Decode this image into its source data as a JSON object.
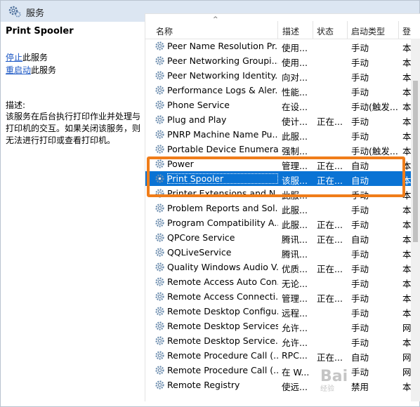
{
  "window": {
    "title": "服务",
    "icon": "gear-icon"
  },
  "left_pane": {
    "service_title": "Print Spooler",
    "actions": [
      {
        "link": "停止",
        "suffix": "此服务"
      },
      {
        "link": "重启动",
        "suffix": "此服务"
      }
    ],
    "description_label": "描述:",
    "description_text": "该服务在后台执行打印作业并处理与打印机的交互。如果关闭该服务，则无法进行打印或查看打印机。"
  },
  "table": {
    "columns": [
      "名称",
      "描述",
      "状态",
      "启动类型",
      "登"
    ],
    "sorted_column": "名称",
    "rows": [
      {
        "name": "Peer Name Resolution Pr...",
        "desc": "使用...",
        "status": "",
        "startup": "手动",
        "more": "本"
      },
      {
        "name": "Peer Networking Groupi...",
        "desc": "使用...",
        "status": "",
        "startup": "手动",
        "more": "本"
      },
      {
        "name": "Peer Networking Identity...",
        "desc": "向对...",
        "status": "",
        "startup": "手动",
        "more": "本"
      },
      {
        "name": "Performance Logs & Aler...",
        "desc": "性能...",
        "status": "",
        "startup": "手动",
        "more": "本"
      },
      {
        "name": "Phone Service",
        "desc": "在设...",
        "status": "",
        "startup": "手动(触发...",
        "more": "本"
      },
      {
        "name": "Plug and Play",
        "desc": "使计...",
        "status": "正在...",
        "startup": "手动",
        "more": "本"
      },
      {
        "name": "PNRP Machine Name Pu...",
        "desc": "此服...",
        "status": "",
        "startup": "手动",
        "more": "本"
      },
      {
        "name": "Portable Device Enumera...",
        "desc": "强制...",
        "status": "",
        "startup": "手动(触发...",
        "more": "本"
      },
      {
        "name": "Power",
        "desc": "管理...",
        "status": "正在...",
        "startup": "自动",
        "more": "本"
      },
      {
        "name": "Print Spooler",
        "desc": "该服...",
        "status": "正在...",
        "startup": "自动",
        "more": "本",
        "selected": true
      },
      {
        "name": "Printer Extensions and N...",
        "desc": "此服...",
        "status": "",
        "startup": "手动",
        "more": "本"
      },
      {
        "name": "Problem Reports and Sol...",
        "desc": "此服...",
        "status": "",
        "startup": "手动",
        "more": "本"
      },
      {
        "name": "Program Compatibility A...",
        "desc": "此服...",
        "status": "正在...",
        "startup": "手动",
        "more": "本"
      },
      {
        "name": "QPCore Service",
        "desc": "腾讯...",
        "status": "正在...",
        "startup": "自动",
        "more": "本"
      },
      {
        "name": "QQLiveService",
        "desc": "腾讯...",
        "status": "",
        "startup": "手动",
        "more": "本"
      },
      {
        "name": "Quality Windows Audio V...",
        "desc": "优质...",
        "status": "正在...",
        "startup": "手动",
        "more": "本"
      },
      {
        "name": "Remote Access Auto Con...",
        "desc": "无论...",
        "status": "",
        "startup": "手动",
        "more": "本"
      },
      {
        "name": "Remote Access Connecti...",
        "desc": "管理...",
        "status": "正在...",
        "startup": "手动",
        "more": "本"
      },
      {
        "name": "Remote Desktop Configu...",
        "desc": "远程...",
        "status": "",
        "startup": "手动",
        "more": "本"
      },
      {
        "name": "Remote Desktop Services",
        "desc": "允许...",
        "status": "",
        "startup": "手动",
        "more": "网"
      },
      {
        "name": "Remote Desktop Service...",
        "desc": "允许...",
        "status": "",
        "startup": "手动",
        "more": "本"
      },
      {
        "name": "Remote Procedure Call (...",
        "desc": "RPC...",
        "status": "正在...",
        "startup": "自动",
        "more": "网"
      },
      {
        "name": "Remote Procedure Call (...",
        "desc": "在 W...",
        "status": "",
        "startup": "手动",
        "more": "网"
      },
      {
        "name": "Remote Registry",
        "desc": "使远...",
        "status": "",
        "startup": "禁用",
        "more": "本"
      }
    ]
  },
  "watermark": {
    "text": "Bai",
    "sub": "经验"
  },
  "colors": {
    "selection": "#0a73d4",
    "highlight_box": "#f07d1a",
    "link": "#1a56c4",
    "titlebar": "#dce6f2"
  }
}
